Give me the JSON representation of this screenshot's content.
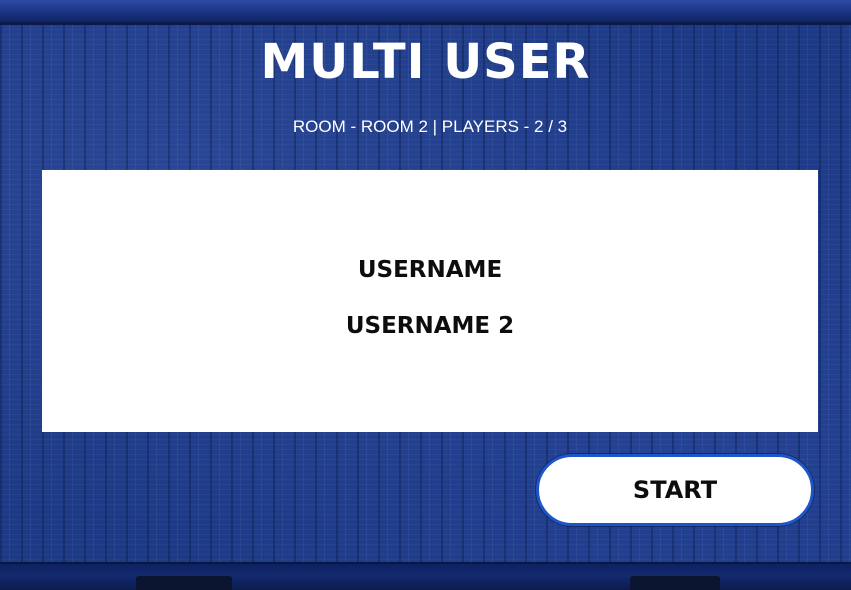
{
  "screen": {
    "title": "MULTI USER",
    "room_info": "ROOM - ROOM 2 | PLAYERS - 2 / 3"
  },
  "players": [
    {
      "name": "USERNAME"
    },
    {
      "name": "USERNAME 2"
    }
  ],
  "actions": {
    "start_label": "START"
  },
  "colors": {
    "background": "#1d3a86",
    "panel": "#ffffff",
    "button_border": "#1e55c8",
    "title_text": "#ffffff",
    "panel_text": "#0d0d0d"
  }
}
